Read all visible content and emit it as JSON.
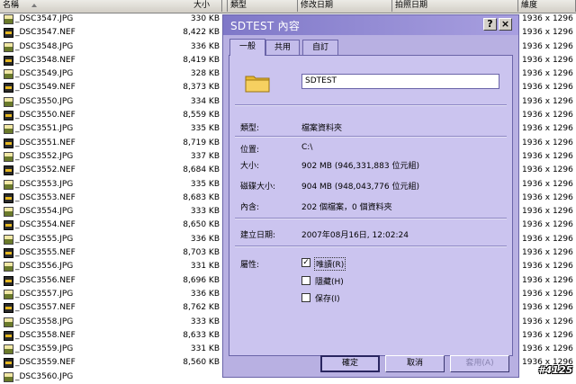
{
  "columns": {
    "name": "名稱",
    "size": "大小",
    "type": "類型",
    "modified": "修改日期",
    "photo_date": "拍照日期",
    "dimensions": "維度"
  },
  "files": [
    {
      "name": "_DSC3547.JPG",
      "size": "330 KB",
      "kind": "jpg",
      "dims": "1936 x 1296"
    },
    {
      "name": "_DSC3547.NEF",
      "size": "8,422 KB",
      "kind": "nef",
      "dims": "1936 x 1296"
    },
    {
      "name": "_DSC3548.JPG",
      "size": "336 KB",
      "kind": "jpg",
      "dims": "1936 x 1296"
    },
    {
      "name": "_DSC3548.NEF",
      "size": "8,419 KB",
      "kind": "nef",
      "dims": "1936 x 1296"
    },
    {
      "name": "_DSC3549.JPG",
      "size": "328 KB",
      "kind": "jpg",
      "dims": "1936 x 1296"
    },
    {
      "name": "_DSC3549.NEF",
      "size": "8,373 KB",
      "kind": "nef",
      "dims": "1936 x 1296"
    },
    {
      "name": "_DSC3550.JPG",
      "size": "334 KB",
      "kind": "jpg",
      "dims": "1936 x 1296"
    },
    {
      "name": "_DSC3550.NEF",
      "size": "8,559 KB",
      "kind": "nef",
      "dims": "1936 x 1296"
    },
    {
      "name": "_DSC3551.JPG",
      "size": "335 KB",
      "kind": "jpg",
      "dims": "1936 x 1296"
    },
    {
      "name": "_DSC3551.NEF",
      "size": "8,719 KB",
      "kind": "nef",
      "dims": "1936 x 1296"
    },
    {
      "name": "_DSC3552.JPG",
      "size": "337 KB",
      "kind": "jpg",
      "dims": "1936 x 1296"
    },
    {
      "name": "_DSC3552.NEF",
      "size": "8,684 KB",
      "kind": "nef",
      "dims": "1936 x 1296"
    },
    {
      "name": "_DSC3553.JPG",
      "size": "335 KB",
      "kind": "jpg",
      "dims": "1936 x 1296"
    },
    {
      "name": "_DSC3553.NEF",
      "size": "8,683 KB",
      "kind": "nef",
      "dims": "1936 x 1296"
    },
    {
      "name": "_DSC3554.JPG",
      "size": "333 KB",
      "kind": "jpg",
      "dims": "1936 x 1296"
    },
    {
      "name": "_DSC3554.NEF",
      "size": "8,650 KB",
      "kind": "nef",
      "dims": "1936 x 1296"
    },
    {
      "name": "_DSC3555.JPG",
      "size": "336 KB",
      "kind": "jpg",
      "dims": "1936 x 1296"
    },
    {
      "name": "_DSC3555.NEF",
      "size": "8,703 KB",
      "kind": "nef",
      "dims": "1936 x 1296"
    },
    {
      "name": "_DSC3556.JPG",
      "size": "331 KB",
      "kind": "jpg",
      "dims": "1936 x 1296"
    },
    {
      "name": "_DSC3556.NEF",
      "size": "8,696 KB",
      "kind": "nef",
      "dims": "1936 x 1296"
    },
    {
      "name": "_DSC3557.JPG",
      "size": "336 KB",
      "kind": "jpg",
      "dims": "1936 x 1296"
    },
    {
      "name": "_DSC3557.NEF",
      "size": "8,762 KB",
      "kind": "nef",
      "dims": "1936 x 1296"
    },
    {
      "name": "_DSC3558.JPG",
      "size": "333 KB",
      "kind": "jpg",
      "dims": "1936 x 1296"
    },
    {
      "name": "_DSC3558.NEF",
      "size": "8,633 KB",
      "kind": "nef",
      "dims": "1936 x 1296"
    },
    {
      "name": "_DSC3559.JPG",
      "size": "331 KB",
      "kind": "jpg",
      "dims": "1936 x 1296"
    },
    {
      "name": "_DSC3559.NEF",
      "size": "8,560 KB",
      "kind": "nef",
      "dims": "1936 x 1296"
    },
    {
      "name": "_DSC3560.JPG",
      "size": "",
      "kind": "jpg",
      "dims": ""
    }
  ],
  "dialog": {
    "title": "SDTEST 內容",
    "help": "?",
    "close": "×",
    "tabs": [
      "一般",
      "共用",
      "自訂"
    ],
    "folder_name": "SDTEST",
    "type_label": "類型:",
    "type_value": "檔案資料夾",
    "location_label": "位置:",
    "location_value": "C:\\",
    "size_label": "大小:",
    "size_value": "902 MB (946,331,883 位元組)",
    "disk_size_label": "磁碟大小:",
    "disk_size_value": "904 MB (948,043,776 位元組)",
    "contains_label": "內含:",
    "contains_value": "202 個檔案，0 個資料夾",
    "created_label": "建立日期:",
    "created_value": "2007年08月16日, 12:02:24",
    "attributes_label": "屬性:",
    "attr_readonly": "唯讀(R)",
    "attr_hidden": "隱藏(H)",
    "attr_archive": "保存(I)",
    "readonly_checked": true,
    "hidden_checked": false,
    "archive_checked": false,
    "ok": "確定",
    "cancel": "取消",
    "apply": "套用(A)"
  },
  "watermark": "#4125",
  "colors": {
    "dialog_bg": "#b8b0e2",
    "panel_bg": "#cbc4ef",
    "titlebar": "#7f78c8",
    "header_bg": "#d4d0c8"
  }
}
